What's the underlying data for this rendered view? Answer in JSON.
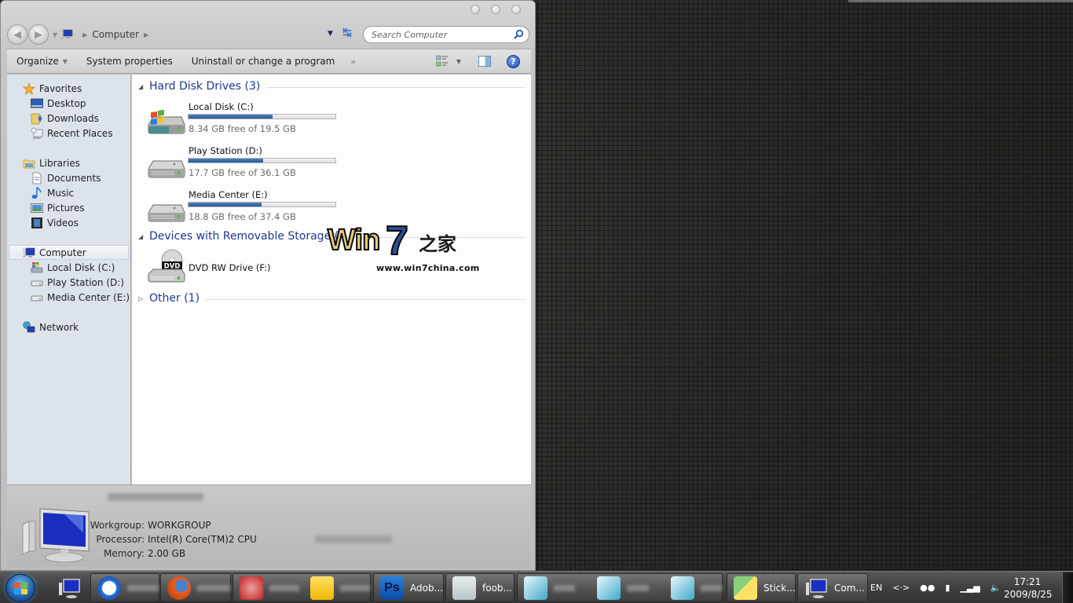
{
  "window": {
    "breadcrumb": [
      "Computer"
    ],
    "search_placeholder": "Search Computer",
    "commands": {
      "organize": "Organize",
      "system_properties": "System properties",
      "uninstall": "Uninstall or change a program",
      "more": "»"
    }
  },
  "sidebar": {
    "favorites": {
      "label": "Favorites",
      "items": [
        "Desktop",
        "Downloads",
        "Recent Places"
      ]
    },
    "libraries": {
      "label": "Libraries",
      "items": [
        "Documents",
        "Music",
        "Pictures",
        "Videos"
      ]
    },
    "computer": {
      "label": "Computer",
      "items": [
        "Local Disk (C:)",
        "Play Station (D:)",
        "Media Center (E:)"
      ]
    },
    "network": {
      "label": "Network"
    }
  },
  "content": {
    "groups": [
      {
        "title": "Hard Disk Drives (3)",
        "expanded": true,
        "drives": [
          {
            "name": "Local Disk (C:)",
            "info": "8.34 GB free of 19.5 GB",
            "used_fraction": 0.572,
            "icon": "windows-drive-icon"
          },
          {
            "name": "Play Station (D:)",
            "info": "17.7 GB free of 36.1 GB",
            "used_fraction": 0.51,
            "icon": "hard-drive-icon"
          },
          {
            "name": "Media Center (E:)",
            "info": "18.8 GB free of 37.4 GB",
            "used_fraction": 0.497,
            "icon": "hard-drive-icon"
          }
        ]
      },
      {
        "title": "Devices with Removable Storage (",
        "expanded": true,
        "drives": [
          {
            "name": "DVD RW Drive (F:)",
            "icon": "dvd-drive-icon"
          }
        ]
      },
      {
        "title": "Other (1)",
        "expanded": false
      }
    ],
    "watermark": {
      "win": "Win",
      "seven": "7",
      "cn": "之家",
      "url": "www.win7china.com"
    }
  },
  "details": {
    "workgroup_label": "Workgroup:",
    "workgroup": "WORKGROUP",
    "processor_label": "Processor:",
    "processor": "Intel(R) Core(TM)2 CPU",
    "memory_label": "Memory:",
    "memory": "2.00 GB"
  },
  "taskbar": {
    "buttons": [
      {
        "label": "",
        "icon": "computer-icon",
        "pinned": true
      },
      {
        "label": "",
        "icon": "thunder-icon",
        "blurred": true
      },
      {
        "label": "",
        "icon": "firefox-icon",
        "blurred": true
      },
      {
        "label": "",
        "icon": "people-icon",
        "blurred": true
      },
      {
        "label": "",
        "icon": "note-icon",
        "blurred": true
      },
      {
        "label": "Adob...",
        "icon": "photoshop-icon"
      },
      {
        "label": "foob...",
        "icon": "foobar-icon"
      },
      {
        "label": "",
        "icon": "notepad-icon",
        "blurred": true
      },
      {
        "label": "",
        "icon": "notepad-icon",
        "blurred": true
      },
      {
        "label": "",
        "icon": "notepad-icon",
        "blurred": true
      },
      {
        "label": "Stick...",
        "icon": "sticky-notes-icon"
      },
      {
        "label": "Com...",
        "icon": "computer-icon"
      }
    ],
    "tray": {
      "language": "EN"
    },
    "clock": {
      "time": "17:21",
      "date": "2009/8/25"
    }
  }
}
